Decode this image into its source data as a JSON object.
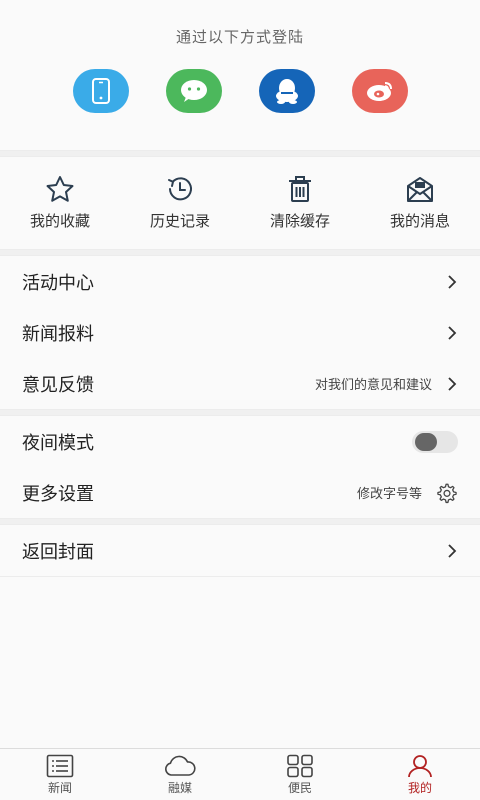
{
  "login": {
    "title": "通过以下方式登陆",
    "methods": [
      {
        "icon": "phone-icon",
        "color": "#3aabe8"
      },
      {
        "icon": "wechat-icon",
        "color": "#4cb85c"
      },
      {
        "icon": "qq-icon",
        "color": "#1565b8"
      },
      {
        "icon": "weibo-icon",
        "color": "#e8645a"
      }
    ]
  },
  "shortcuts": [
    {
      "label": "我的收藏",
      "icon": "star-icon"
    },
    {
      "label": "历史记录",
      "icon": "history-icon"
    },
    {
      "label": "清除缓存",
      "icon": "trash-icon"
    },
    {
      "label": "我的消息",
      "icon": "mail-icon"
    }
  ],
  "menu1": [
    {
      "label": "活动中心"
    },
    {
      "label": "新闻报料"
    },
    {
      "label": "意见反馈",
      "hint": "对我们的意见和建议"
    }
  ],
  "menu2": {
    "night_mode": {
      "label": "夜间模式",
      "enabled": false
    },
    "more_settings": {
      "label": "更多设置",
      "hint": "修改字号等"
    }
  },
  "menu3": [
    {
      "label": "返回封面"
    }
  ],
  "tabbar": [
    {
      "label": "新闻",
      "icon": "news-list-icon",
      "active": false
    },
    {
      "label": "融媒",
      "icon": "cloud-icon",
      "active": false
    },
    {
      "label": "便民",
      "icon": "grid-icon",
      "active": false
    },
    {
      "label": "我的",
      "icon": "user-icon",
      "active": true
    }
  ],
  "colors": {
    "accent": "#b22222",
    "icon_dark": "#2c3e50"
  }
}
